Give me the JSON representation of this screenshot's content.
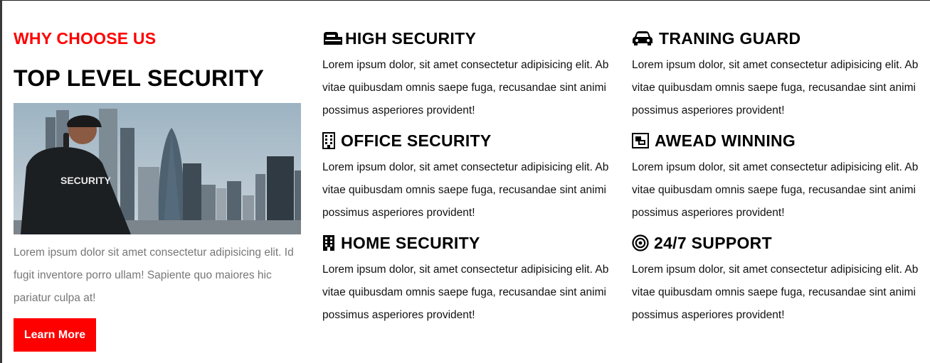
{
  "intro": {
    "eyebrow": "WHY CHOOSE US",
    "title": "TOP LEVEL SECURITY",
    "image_label": "SECURITY",
    "text": "Lorem ipsum dolor sit amet consectetur adipisicing elit. Id fugit inventore porro ullam! Sapiente quo maiores hic pariatur culpa at!",
    "button_label": "Learn More"
  },
  "features": [
    {
      "icon": "mail-slot-icon",
      "title": "HIGH SECURITY",
      "text": "Lorem ipsum dolor, sit amet consectetur adipisicing elit. Ab vitae quibusdam omnis saepe fuga, recusandae sint animi possimus asperiores provident!"
    },
    {
      "icon": "car-icon",
      "title": "TRANING GUARD",
      "text": "Lorem ipsum dolor, sit amet consectetur adipisicing elit. Ab vitae quibusdam omnis saepe fuga, recusandae sint animi possimus asperiores provident!"
    },
    {
      "icon": "building-icon",
      "title": "OFFICE SECURITY",
      "text": "Lorem ipsum dolor, sit amet consectetur adipisicing elit. Ab vitae quibusdam omnis saepe fuga, recusandae sint animi possimus asperiores provident!"
    },
    {
      "icon": "award-icon",
      "title": "AWEAD WINNING",
      "text": "Lorem ipsum dolor, sit amet consectetur adipisicing elit. Ab vitae quibusdam omnis saepe fuga, recusandae sint animi possimus asperiores provident!"
    },
    {
      "icon": "building-solid-icon",
      "title": "HOME SECURITY",
      "text": "Lorem ipsum dolor, sit amet consectetur adipisicing elit. Ab vitae quibusdam omnis saepe fuga, recusandae sint animi possimus asperiores provident!"
    },
    {
      "icon": "bullseye-icon",
      "title": "24/7 SUPPORT",
      "text": "Lorem ipsum dolor, sit amet consectetur adipisicing elit. Ab vitae quibusdam omnis saepe fuga, recusandae sint animi possimus asperiores provident!"
    }
  ],
  "colors": {
    "accent": "#ff0000",
    "heading": "#000000",
    "muted_text": "#777777"
  }
}
